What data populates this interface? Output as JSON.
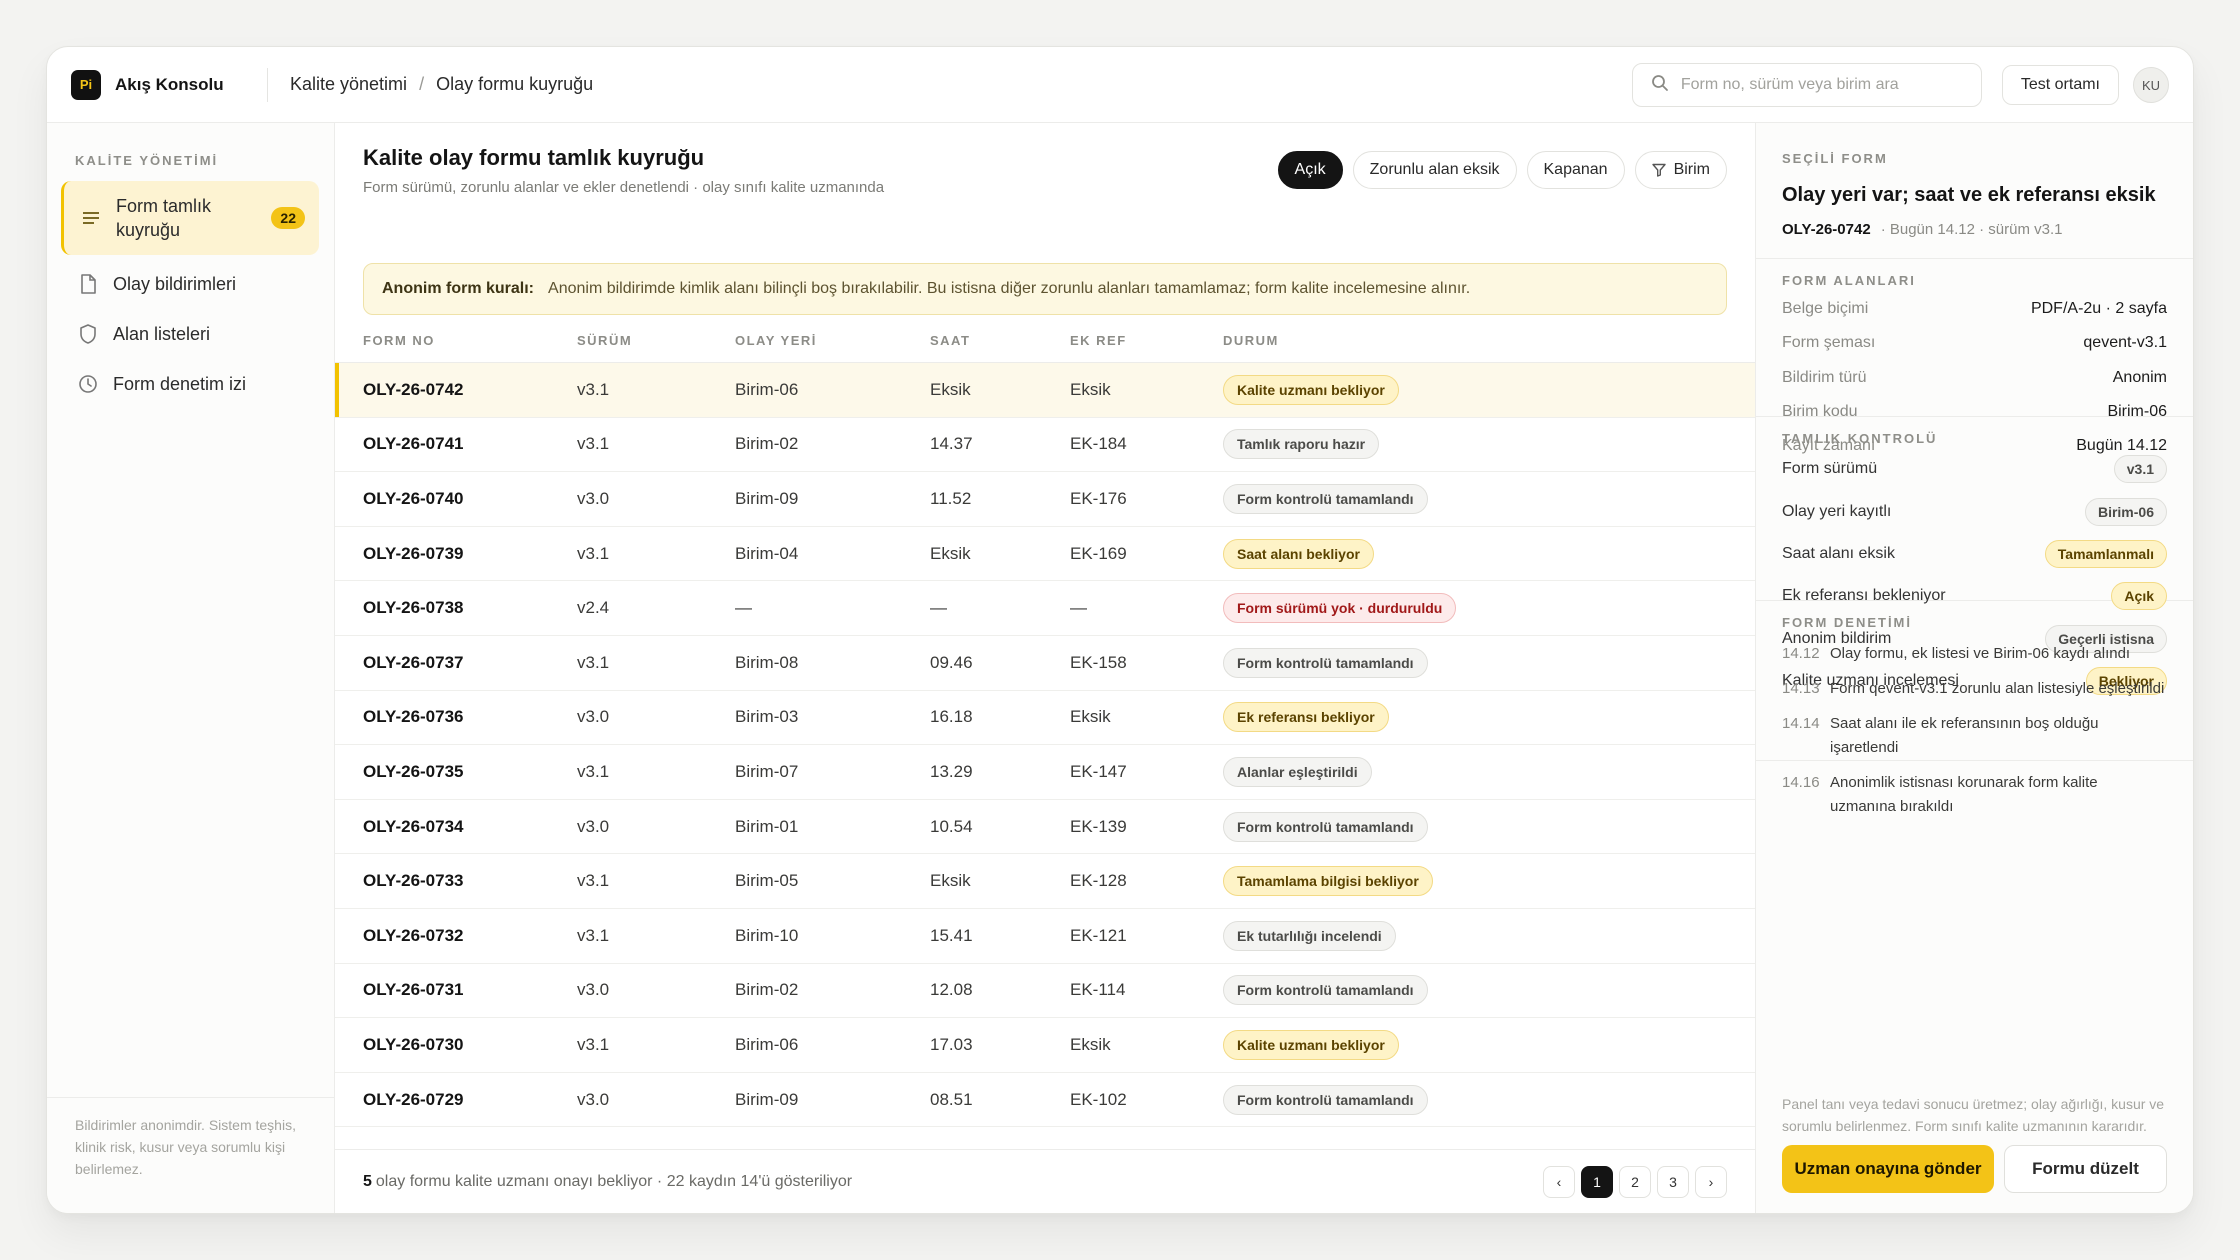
{
  "app": {
    "logo": "Pi",
    "name": "Akış Konsolu"
  },
  "breadcrumb": {
    "section": "Kalite yönetimi",
    "separator": "/",
    "page": "Olay formu kuyruğu"
  },
  "search": {
    "placeholder": "Form no, sürüm veya birim ara",
    "value": ""
  },
  "env_button": "Test ortamı",
  "avatar": "KU",
  "sidebar": {
    "heading": "KALİTE YÖNETİMİ",
    "items": [
      {
        "label": "Form tamlık kuyruğu",
        "count": "22",
        "icon": "list-icon"
      },
      {
        "label": "Olay bildirimleri",
        "icon": "document-icon"
      },
      {
        "label": "Alan listeleri",
        "icon": "shield-icon"
      },
      {
        "label": "Form denetim izi",
        "icon": "clock-icon"
      }
    ],
    "footer": "Bildirimler anonimdir. Sistem teşhis, klinik risk, kusur veya sorumlu kişi belirlemez."
  },
  "main": {
    "title": "Kalite olay formu tamlık kuyruğu",
    "subtitle": "Form sürümü, zorunlu alanlar ve ekler denetlendi · olay sınıfı kalite uzmanında",
    "filters": [
      "Açık",
      "Zorunlu alan eksik",
      "Kapanan",
      "Birim"
    ],
    "notice": {
      "label": "Anonim form kuralı:",
      "text": "Anonim bildirimde kimlik alanı bilinçli boş bırakılabilir. Bu istisna diğer zorunlu alanları tamamlamaz; form kalite incelemesine alınır."
    },
    "columns": [
      "FORM NO",
      "SÜRÜM",
      "OLAY YERİ",
      "SAAT",
      "EK REF",
      "DURUM"
    ],
    "rows": [
      {
        "no": "OLY-26-0742",
        "ver": "v3.1",
        "loc": "Birim-06",
        "time": "Eksik",
        "ref": "Eksik",
        "status": "Kalite uzmanı bekliyor",
        "tone": "amber"
      },
      {
        "no": "OLY-26-0741",
        "ver": "v3.1",
        "loc": "Birim-02",
        "time": "14.37",
        "ref": "EK-184",
        "status": "Tamlık raporu hazır",
        "tone": "gray"
      },
      {
        "no": "OLY-26-0740",
        "ver": "v3.0",
        "loc": "Birim-09",
        "time": "11.52",
        "ref": "EK-176",
        "status": "Form kontrolü tamamlandı",
        "tone": "gray"
      },
      {
        "no": "OLY-26-0739",
        "ver": "v3.1",
        "loc": "Birim-04",
        "time": "Eksik",
        "ref": "EK-169",
        "status": "Saat alanı bekliyor",
        "tone": "amber"
      },
      {
        "no": "OLY-26-0738",
        "ver": "v2.4",
        "loc": "—",
        "time": "—",
        "ref": "—",
        "status": "Form sürümü yok · durduruldu",
        "tone": "red"
      },
      {
        "no": "OLY-26-0737",
        "ver": "v3.1",
        "loc": "Birim-08",
        "time": "09.46",
        "ref": "EK-158",
        "status": "Form kontrolü tamamlandı",
        "tone": "gray"
      },
      {
        "no": "OLY-26-0736",
        "ver": "v3.0",
        "loc": "Birim-03",
        "time": "16.18",
        "ref": "Eksik",
        "status": "Ek referansı bekliyor",
        "tone": "amber"
      },
      {
        "no": "OLY-26-0735",
        "ver": "v3.1",
        "loc": "Birim-07",
        "time": "13.29",
        "ref": "EK-147",
        "status": "Alanlar eşleştirildi",
        "tone": "gray"
      },
      {
        "no": "OLY-26-0734",
        "ver": "v3.0",
        "loc": "Birim-01",
        "time": "10.54",
        "ref": "EK-139",
        "status": "Form kontrolü tamamlandı",
        "tone": "gray"
      },
      {
        "no": "OLY-26-0733",
        "ver": "v3.1",
        "loc": "Birim-05",
        "time": "Eksik",
        "ref": "EK-128",
        "status": "Tamamlama bilgisi bekliyor",
        "tone": "amber"
      },
      {
        "no": "OLY-26-0732",
        "ver": "v3.1",
        "loc": "Birim-10",
        "time": "15.41",
        "ref": "EK-121",
        "status": "Ek tutarlılığı incelendi",
        "tone": "gray"
      },
      {
        "no": "OLY-26-0731",
        "ver": "v3.0",
        "loc": "Birim-02",
        "time": "12.08",
        "ref": "EK-114",
        "status": "Form kontrolü tamamlandı",
        "tone": "gray"
      },
      {
        "no": "OLY-26-0730",
        "ver": "v3.1",
        "loc": "Birim-06",
        "time": "17.03",
        "ref": "Eksik",
        "status": "Kalite uzmanı bekliyor",
        "tone": "amber"
      },
      {
        "no": "OLY-26-0729",
        "ver": "v3.0",
        "loc": "Birim-09",
        "time": "08.51",
        "ref": "EK-102",
        "status": "Form kontrolü tamamlandı",
        "tone": "gray"
      }
    ],
    "footer": {
      "count": "5",
      "text": "olay formu kalite uzmanı onayı bekliyor · 22 kaydın 14'ü gösteriliyor"
    },
    "pagination": [
      "‹",
      "1",
      "2",
      "3",
      "›"
    ]
  },
  "panel": {
    "selected_label": "SEÇİLİ FORM",
    "selected_title": "Olay yeri var; saat ve ek referansı eksik",
    "selected_no": "OLY-26-0742",
    "selected_meta": "· Bugün 14.12 · sürüm v3.1",
    "fields_label": "FORM ALANLARI",
    "fields": [
      {
        "k": "Belge biçimi",
        "v": "PDF/A-2u · 2 sayfa"
      },
      {
        "k": "Form şeması",
        "v": "qevent-v3.1"
      },
      {
        "k": "Bildirim türü",
        "v": "Anonim"
      },
      {
        "k": "Birim kodu",
        "v": "Birim-06"
      },
      {
        "k": "Kayıt zamanı",
        "v": "Bugün 14.12"
      }
    ],
    "checks_label": "TAMLIK KONTROLÜ",
    "checks": [
      {
        "k": "Form sürümü",
        "v": "v3.1",
        "tone": "gray"
      },
      {
        "k": "Olay yeri kayıtlı",
        "v": "Birim-06",
        "tone": "gray"
      },
      {
        "k": "Saat alanı eksik",
        "v": "Tamamlanmalı",
        "tone": "amber"
      },
      {
        "k": "Ek referansı bekleniyor",
        "v": "Açık",
        "tone": "amber"
      },
      {
        "k": "Anonim bildirim",
        "v": "Geçerli istisna",
        "tone": "gray"
      },
      {
        "k": "Kalite uzmanı incelemesi",
        "v": "Bekliyor",
        "tone": "amber"
      }
    ],
    "audit_label": "FORM DENETİMİ",
    "audit": [
      {
        "t": "14.12",
        "text": "Olay formu, ek listesi ve Birim-06 kaydı alındı"
      },
      {
        "t": "14.13",
        "text": "Form qevent-v3.1 zorunlu alan listesiyle eşleştirildi"
      },
      {
        "t": "14.14",
        "text": "Saat alanı ile ek referansının boş olduğu işaretlendi"
      },
      {
        "t": "14.16",
        "text": "Anonimlik istisnası korunarak form kalite uzmanına bırakıldı"
      }
    ],
    "note": "Panel tanı veya tedavi sonucu üretmez; olay ağırlığı, kusur ve sorumlu belirlenmez. Form sınıfı kalite uzmanının kararıdır.",
    "primary": "Uzman onayına gönder",
    "secondary": "Formu düzelt"
  },
  "colors": {
    "accent": "#f3c317",
    "dark": "#141414",
    "alert": "#a11919"
  }
}
